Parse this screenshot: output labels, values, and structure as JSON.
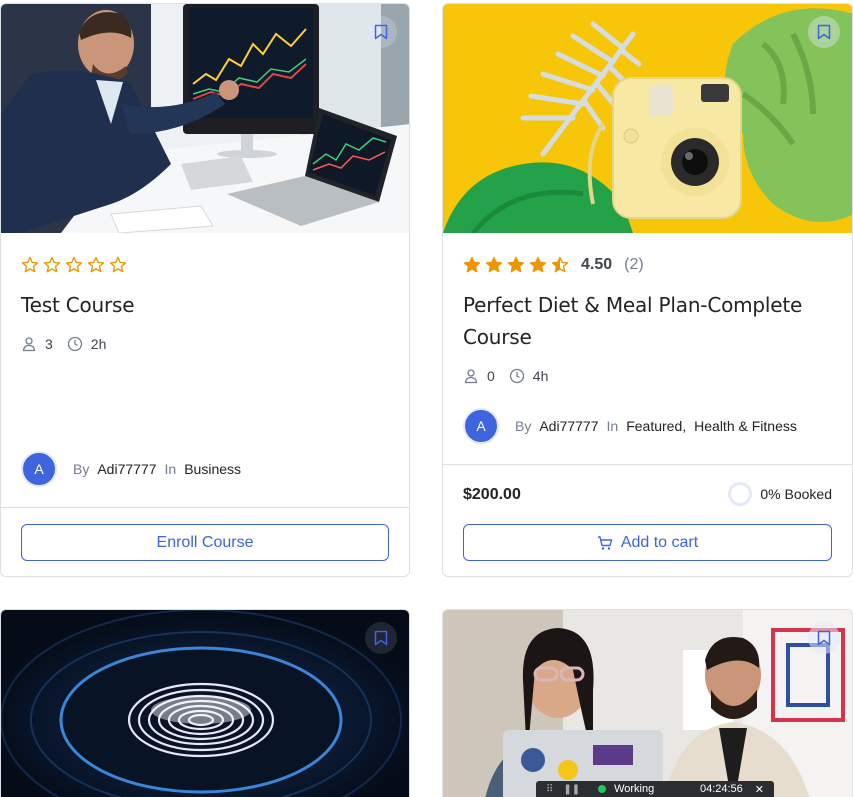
{
  "colors": {
    "primary": "#3e64de",
    "star": "#ed9700",
    "border": "#dcdfe5",
    "muted": "#757c8e"
  },
  "cards": [
    {
      "image_subject": "Businessman analyzing trading charts on monitor and laptop",
      "rating_value": 0,
      "title": "Test Course",
      "students": "3",
      "duration": "2h",
      "avatar_initial": "A",
      "by_label": "By",
      "author": "Adi77777",
      "in_label": "In",
      "category": "Business",
      "button_label": "Enroll Course",
      "bookmark_icon": "bookmark-icon"
    },
    {
      "image_subject": "Yellow instant camera with green tropical leaves on yellow background",
      "rating_value": 4.5,
      "rating_text": "4.50",
      "rating_count": "(2)",
      "title_line1": "Perfect Diet & Meal Plan-Complete",
      "title_line2": "Course",
      "students": "0",
      "duration": "4h",
      "avatar_initial": "A",
      "by_label": "By",
      "author": "Adi77777",
      "in_label": "In",
      "category1": "Featured",
      "comma": ",",
      "category2": "Health & Fitness",
      "price": "$200.00",
      "booked": "0% Booked",
      "booked_percent": 0,
      "button_label": "Add to cart",
      "bookmark_icon": "bookmark-icon"
    },
    {
      "image_subject": "Glowing fingerprint scanner on dark blue background",
      "bookmark_icon": "bookmark-icon"
    },
    {
      "image_subject": "Two colleagues in an office looking at a laptop",
      "bookmark_icon": "bookmark-icon"
    }
  ],
  "taskbar": {
    "status": "Working",
    "timer": "04:24:56",
    "close": "✕",
    "grip": "⠿",
    "pause": "❚❚"
  }
}
